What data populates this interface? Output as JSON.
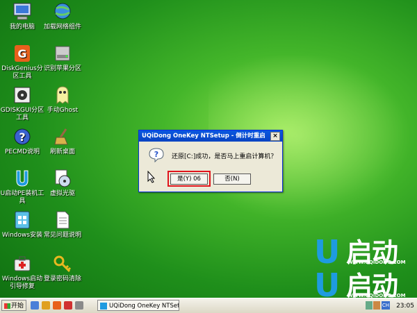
{
  "desktop": {
    "icons": [
      {
        "label": "我的电脑",
        "icon": "my-computer-icon"
      },
      {
        "label": "加载网络组件",
        "icon": "network-globe-icon"
      },
      {
        "label": "DiskGenius分区工具",
        "icon": "diskgenius-icon"
      },
      {
        "label": "识别苹果分区",
        "icon": "disk-drive-icon"
      },
      {
        "label": "GDISKGUI分区工具",
        "icon": "gdisk-icon"
      },
      {
        "label": "手动Ghost",
        "icon": "ghost-icon"
      },
      {
        "label": "PECMD说明",
        "icon": "help-icon"
      },
      {
        "label": "刷新桌面",
        "icon": "broom-icon"
      },
      {
        "label": "U启动PE装机工具",
        "icon": "u-installer-icon"
      },
      {
        "label": "虚拟光驱",
        "icon": "virtual-cd-icon"
      },
      {
        "label": "Windows安装",
        "icon": "windows-install-icon"
      },
      {
        "label": "常见问题说明",
        "icon": "document-icon"
      },
      {
        "label": "Windows启动引导修复",
        "icon": "repair-kit-icon"
      },
      {
        "label": "登录密码清除",
        "icon": "key-icon"
      }
    ]
  },
  "dialog": {
    "title": "UQiDong OneKey NTSetup - 倒计时重启",
    "message": "还原[C:]成功，是否马上重启计算机？",
    "yes_label": "是(Y) 06",
    "no_label": "否(N)",
    "close_glyph": "×"
  },
  "taskbar": {
    "start_label": "开始",
    "task_label": "UQiDong OneKey NTSet...",
    "ime_label": "CH",
    "clock": "23:05"
  },
  "brand": {
    "u": "U",
    "name": "启动",
    "url": "WWW.UQIDONG.COM"
  },
  "colors": {
    "titlebar": "#0a58e0",
    "highlight": "#e0141c",
    "desktop": "#2a9a20"
  }
}
